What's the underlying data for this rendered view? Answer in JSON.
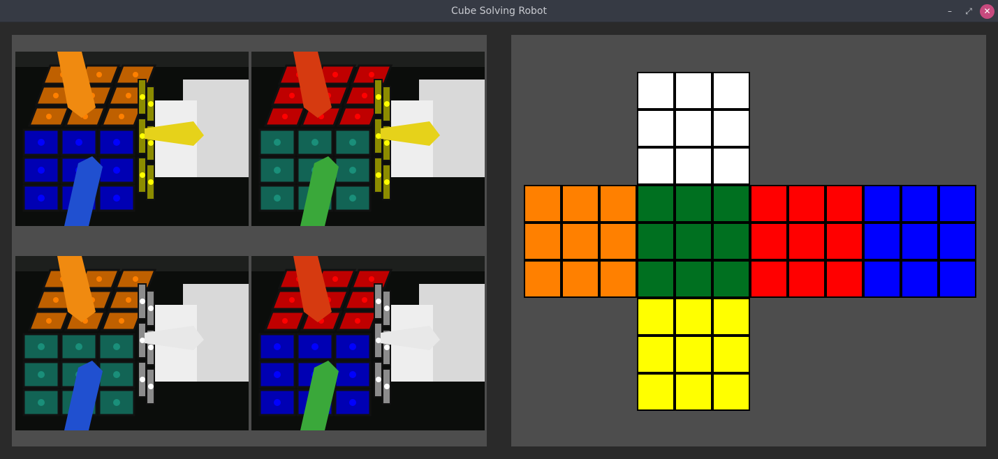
{
  "window": {
    "title": "Cube Solving Robot"
  },
  "controls": {
    "minimize": "–",
    "maximize": "⤢",
    "close": "✕"
  },
  "camera_views": [
    {
      "name": "camera-view-1",
      "faces": [
        "orange",
        "blue",
        "yellow"
      ]
    },
    {
      "name": "camera-view-2",
      "faces": [
        "red",
        "teal",
        "yellow"
      ]
    },
    {
      "name": "camera-view-3",
      "faces": [
        "orange",
        "teal",
        "white"
      ]
    },
    {
      "name": "camera-view-4",
      "faces": [
        "red",
        "blue",
        "white"
      ]
    }
  ],
  "colors": {
    "white": "#ffffff",
    "orange": "#ff8000",
    "green": "#007020",
    "red": "#ff0000",
    "blue": "#0000ff",
    "yellow": "#ffff00",
    "teal": "#1a8f7a"
  },
  "cube_state": {
    "up": [
      [
        "white",
        "white",
        "white"
      ],
      [
        "white",
        "white",
        "white"
      ],
      [
        "white",
        "white",
        "white"
      ]
    ],
    "left": [
      [
        "orange",
        "orange",
        "orange"
      ],
      [
        "orange",
        "orange",
        "orange"
      ],
      [
        "orange",
        "orange",
        "orange"
      ]
    ],
    "front": [
      [
        "green",
        "green",
        "green"
      ],
      [
        "green",
        "green",
        "green"
      ],
      [
        "green",
        "green",
        "green"
      ]
    ],
    "right": [
      [
        "red",
        "red",
        "red"
      ],
      [
        "red",
        "red",
        "red"
      ],
      [
        "red",
        "red",
        "red"
      ]
    ],
    "back": [
      [
        "blue",
        "blue",
        "blue"
      ],
      [
        "blue",
        "blue",
        "blue"
      ],
      [
        "blue",
        "blue",
        "blue"
      ]
    ],
    "down": [
      [
        "yellow",
        "yellow",
        "yellow"
      ],
      [
        "yellow",
        "yellow",
        "yellow"
      ],
      [
        "yellow",
        "yellow",
        "yellow"
      ]
    ]
  }
}
